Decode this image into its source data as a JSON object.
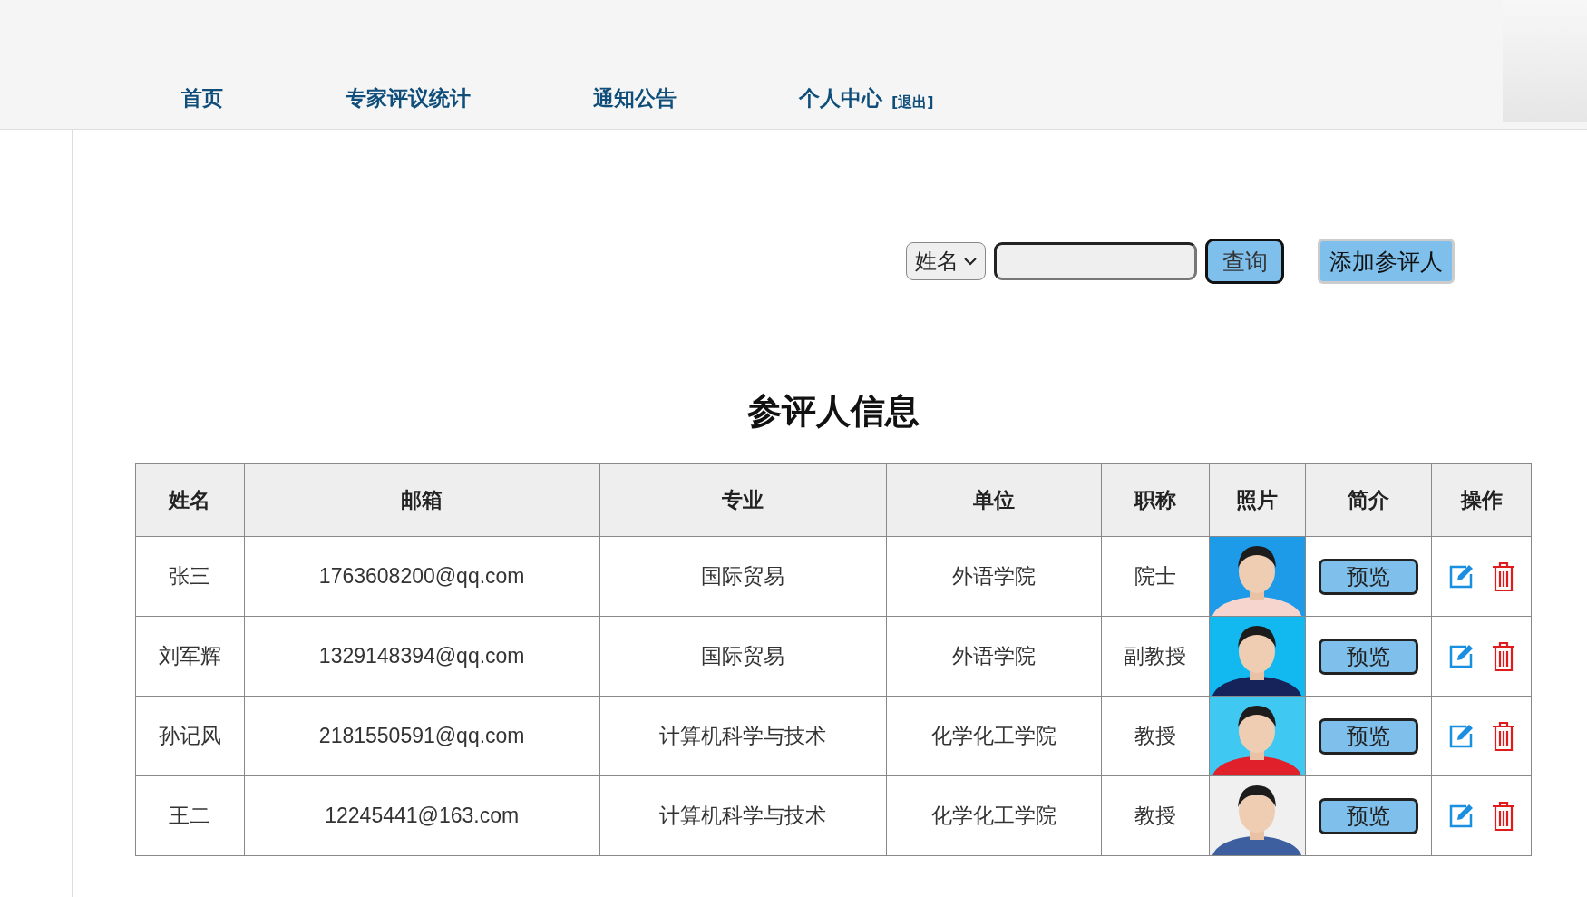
{
  "nav": {
    "items": [
      {
        "label": "首页"
      },
      {
        "label": "专家评议统计"
      },
      {
        "label": "通知公告"
      },
      {
        "label": "个人中心"
      }
    ],
    "logout": "[退出]"
  },
  "search": {
    "field_select": "姓名",
    "button": "查询",
    "add_button": "添加参评人"
  },
  "title": "参评人信息",
  "table": {
    "columns": [
      "姓名",
      "邮箱",
      "专业",
      "单位",
      "职称",
      "照片",
      "简介",
      "操作"
    ],
    "rows": [
      {
        "name": "张三",
        "email": "1763608200@qq.com",
        "major": "国际贸易",
        "unit": "外语学院",
        "rank": "院士",
        "preview": "预览"
      },
      {
        "name": "刘军辉",
        "email": "1329148394@qq.com",
        "major": "国际贸易",
        "unit": "外语学院",
        "rank": "副教授",
        "preview": "预览"
      },
      {
        "name": "孙记风",
        "email": "2181550591@qq.com",
        "major": "计算机科学与技术",
        "unit": "化学化工学院",
        "rank": "教授",
        "preview": "预览"
      },
      {
        "name": "王二",
        "email": "12245441@163.com",
        "major": "计算机科学与技术",
        "unit": "化学化工学院",
        "rank": "教授",
        "preview": "预览"
      }
    ]
  }
}
